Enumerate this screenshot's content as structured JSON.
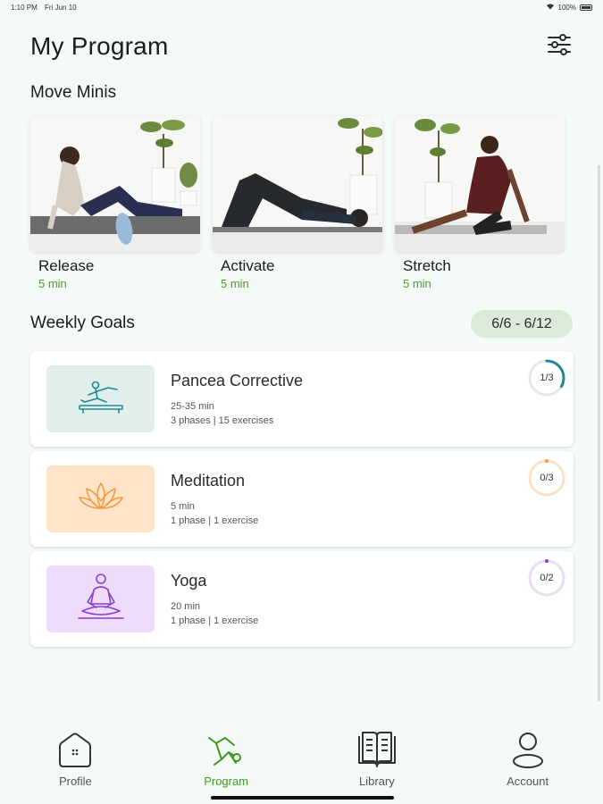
{
  "status_bar": {
    "time": "1:10 PM",
    "date": "Fri Jun 10",
    "battery": "100%"
  },
  "header": {
    "title": "My Program",
    "filter_icon": "sliders-icon"
  },
  "move_minis": {
    "title": "Move Minis",
    "items": [
      {
        "label": "Release",
        "duration": "5 min"
      },
      {
        "label": "Activate",
        "duration": "5 min"
      },
      {
        "label": "Stretch",
        "duration": "5 min"
      }
    ]
  },
  "weekly_goals": {
    "title": "Weekly Goals",
    "date_range": "6/6 - 6/12",
    "items": [
      {
        "name": "Pancea Corrective",
        "duration": "25-35 min",
        "details": "3 phases | 15 exercises",
        "progress": "1/3",
        "progress_fraction": 0.333,
        "icon": "pilates-icon",
        "color": "#1d8a94",
        "bg": "#e2eeec"
      },
      {
        "name": "Meditation",
        "duration": "5 min",
        "details": "1 phase | 1 exercise",
        "progress": "0/3",
        "progress_fraction": 0,
        "icon": "lotus-icon",
        "color": "#f29c3f",
        "bg": "#ffe4c9"
      },
      {
        "name": "Yoga",
        "duration": "20 min",
        "details": "1 phase | 1 exercise",
        "progress": "0/2",
        "progress_fraction": 0,
        "icon": "meditating-person-icon",
        "color": "#8a3fcf",
        "bg": "#eedcfa"
      }
    ]
  },
  "nav": {
    "items": [
      {
        "label": "Profile",
        "icon": "home-icon",
        "active": false
      },
      {
        "label": "Program",
        "icon": "program-icon",
        "active": true
      },
      {
        "label": "Library",
        "icon": "book-icon",
        "active": false
      },
      {
        "label": "Account",
        "icon": "user-icon",
        "active": false
      }
    ]
  },
  "colors": {
    "accent": "#3d9a1e",
    "background": "#f4faf7",
    "date_badge": "#dcebd9"
  }
}
